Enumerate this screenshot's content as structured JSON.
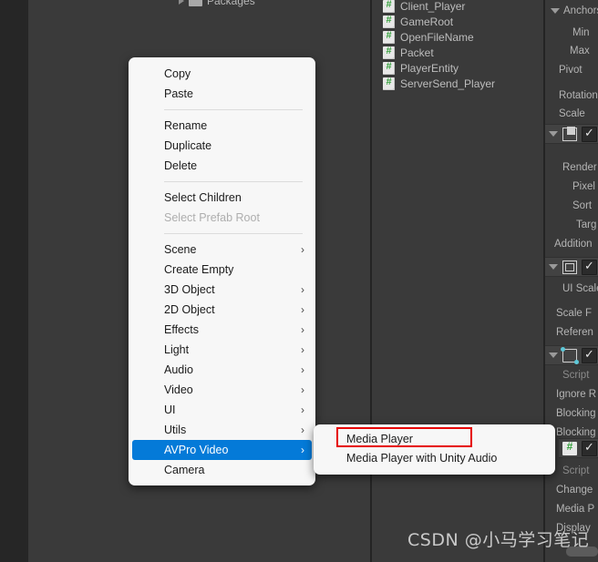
{
  "project_panel": {
    "row_label": "Packages"
  },
  "hierarchy": {
    "items": [
      {
        "label": "Client_Player",
        "icon": "csharp-script-icon"
      },
      {
        "label": "GameRoot",
        "icon": "csharp-script-icon"
      },
      {
        "label": "OpenFileName",
        "icon": "csharp-script-icon"
      },
      {
        "label": "Packet",
        "icon": "csharp-script-icon"
      },
      {
        "label": "PlayerEntity",
        "icon": "csharp-script-icon"
      },
      {
        "label": "ServerSend_Player",
        "icon": "csharp-script-icon"
      }
    ]
  },
  "inspector": {
    "rect_transform": {
      "anchors_label": "Anchors",
      "min_label": "Min",
      "max_label": "Max",
      "pivot_label": "Pivot",
      "rotation_label": "Rotation",
      "scale_label": "Scale"
    },
    "canvas": {
      "icon": "canvas-icon",
      "checked": true,
      "render_label": "Render",
      "pixel_label": "Pixel",
      "sort_label": "Sort",
      "target_label": "Targ",
      "additional_label": "Addition"
    },
    "canvas_scaler": {
      "icon": "canvas-scaler-icon",
      "checked": true,
      "ui_scale_label": "UI Scale",
      "scale_factor_label": "Scale F",
      "reference_label": "Referen"
    },
    "graphic_raycaster": {
      "icon": "graphic-raycaster-icon",
      "checked": true,
      "script_label": "Script",
      "ignore_label": "Ignore R",
      "blocking_objects_label": "Blocking",
      "blocking_mask_label": "Blocking"
    },
    "media_player_component": {
      "icon": "csharp-script-icon",
      "checked": true,
      "script_label": "Script",
      "change_label": "Change",
      "media_label": "Media P",
      "display_label": "Display"
    }
  },
  "context_menu": {
    "items": [
      {
        "label": "Copy",
        "type": "item"
      },
      {
        "label": "Paste",
        "type": "item"
      },
      {
        "type": "separator"
      },
      {
        "label": "Rename",
        "type": "item"
      },
      {
        "label": "Duplicate",
        "type": "item"
      },
      {
        "label": "Delete",
        "type": "item"
      },
      {
        "type": "separator"
      },
      {
        "label": "Select Children",
        "type": "item"
      },
      {
        "label": "Select Prefab Root",
        "type": "item",
        "disabled": true
      },
      {
        "type": "separator"
      },
      {
        "label": "Scene",
        "type": "item",
        "arrow": "›"
      },
      {
        "label": "Create Empty",
        "type": "item"
      },
      {
        "label": "3D Object",
        "type": "item",
        "arrow": "›"
      },
      {
        "label": "2D Object",
        "type": "item",
        "arrow": "›"
      },
      {
        "label": "Effects",
        "type": "item",
        "arrow": "›"
      },
      {
        "label": "Light",
        "type": "item",
        "arrow": "›"
      },
      {
        "label": "Audio",
        "type": "item",
        "arrow": "›"
      },
      {
        "label": "Video",
        "type": "item",
        "arrow": "›"
      },
      {
        "label": "UI",
        "type": "item",
        "arrow": "›"
      },
      {
        "label": "Utils",
        "type": "item",
        "arrow": "›"
      },
      {
        "label": "AVPro Video",
        "type": "item",
        "arrow": "›",
        "selected": true
      },
      {
        "label": "Camera",
        "type": "item"
      }
    ],
    "highlight_color": "#047ad8"
  },
  "submenu": {
    "items": [
      {
        "label": "Media Player",
        "annotated": true
      },
      {
        "label": "Media Player with Unity Audio"
      }
    ],
    "annotation_color": "#e60000"
  },
  "watermark": {
    "text": "CSDN @小马学习笔记"
  }
}
